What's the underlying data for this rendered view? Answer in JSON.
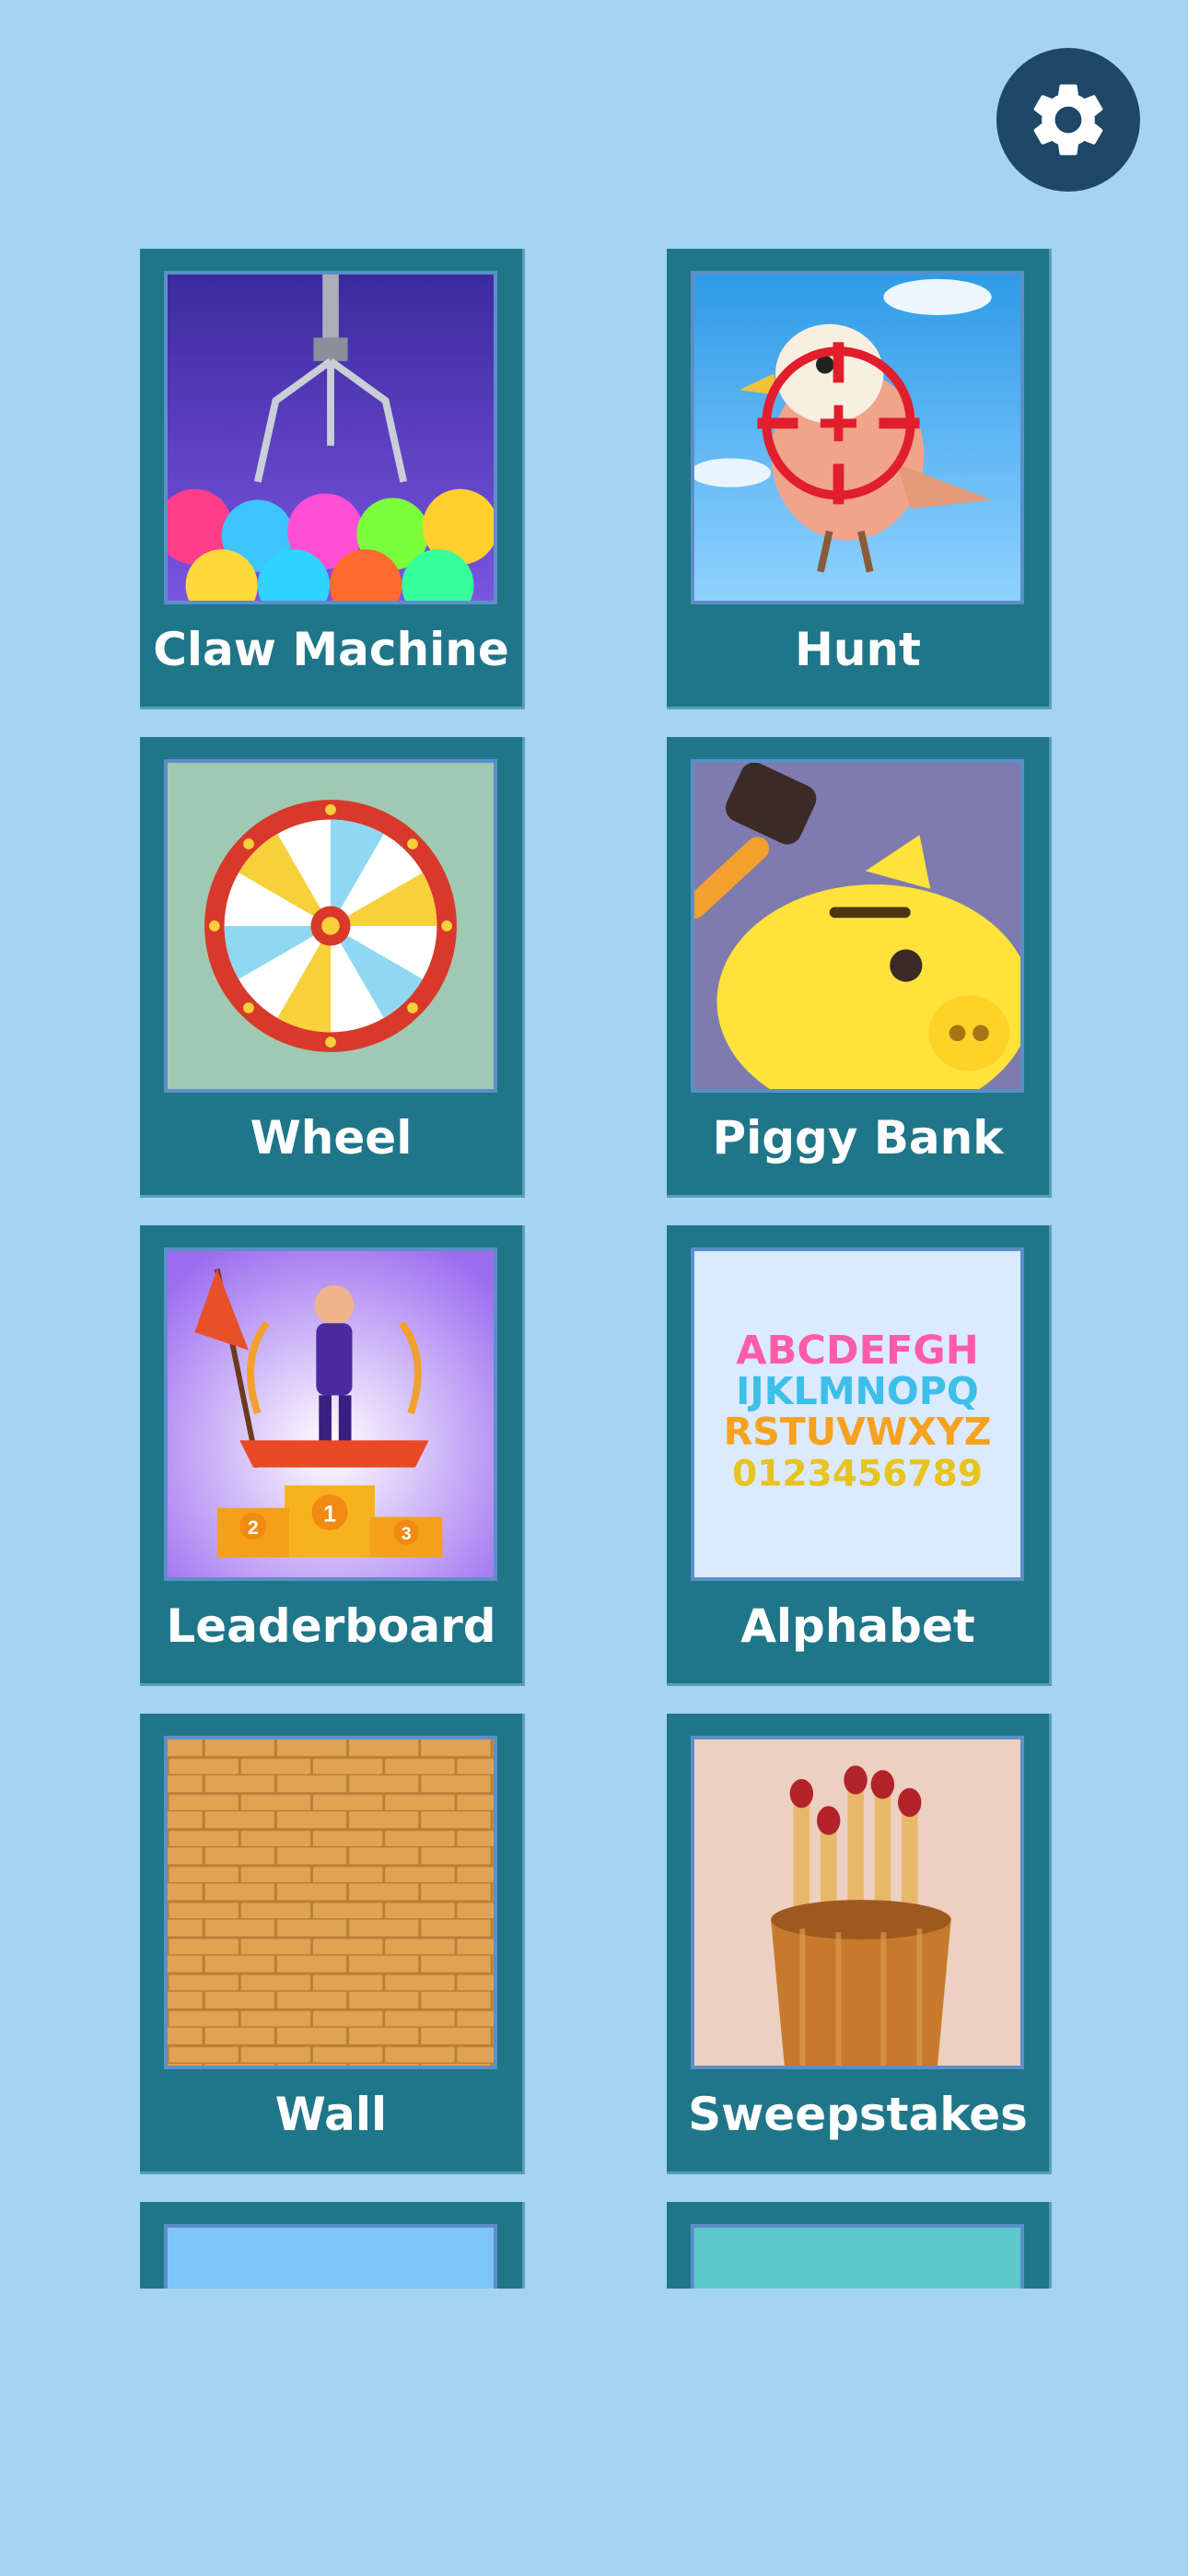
{
  "settings": {
    "icon": "gear-icon"
  },
  "tiles": [
    {
      "label": "Claw Machine",
      "icon": "claw-machine-thumbnail"
    },
    {
      "label": "Hunt",
      "icon": "bird-target-thumbnail"
    },
    {
      "label": "Wheel",
      "icon": "prize-wheel-thumbnail"
    },
    {
      "label": "Piggy Bank",
      "icon": "piggy-bank-thumbnail"
    },
    {
      "label": "Leaderboard",
      "icon": "podium-trophy-thumbnail"
    },
    {
      "label": "Alphabet",
      "icon": "alphabet-letters-thumbnail"
    },
    {
      "label": "Wall",
      "icon": "brick-wall-thumbnail"
    },
    {
      "label": "Sweepstakes",
      "icon": "matchsticks-cup-thumbnail"
    },
    {
      "label": "",
      "icon": "blue-thumbnail"
    },
    {
      "label": "",
      "icon": "teal-thumbnail"
    }
  ],
  "alphabet_art": {
    "row1": "ABCDEFGH",
    "row2": "IJKLMNOPQ",
    "row3": "RSTUVWXYZ",
    "row4": "0123456789"
  },
  "podium_numbers": {
    "first": "1",
    "second": "2",
    "third": "3"
  }
}
